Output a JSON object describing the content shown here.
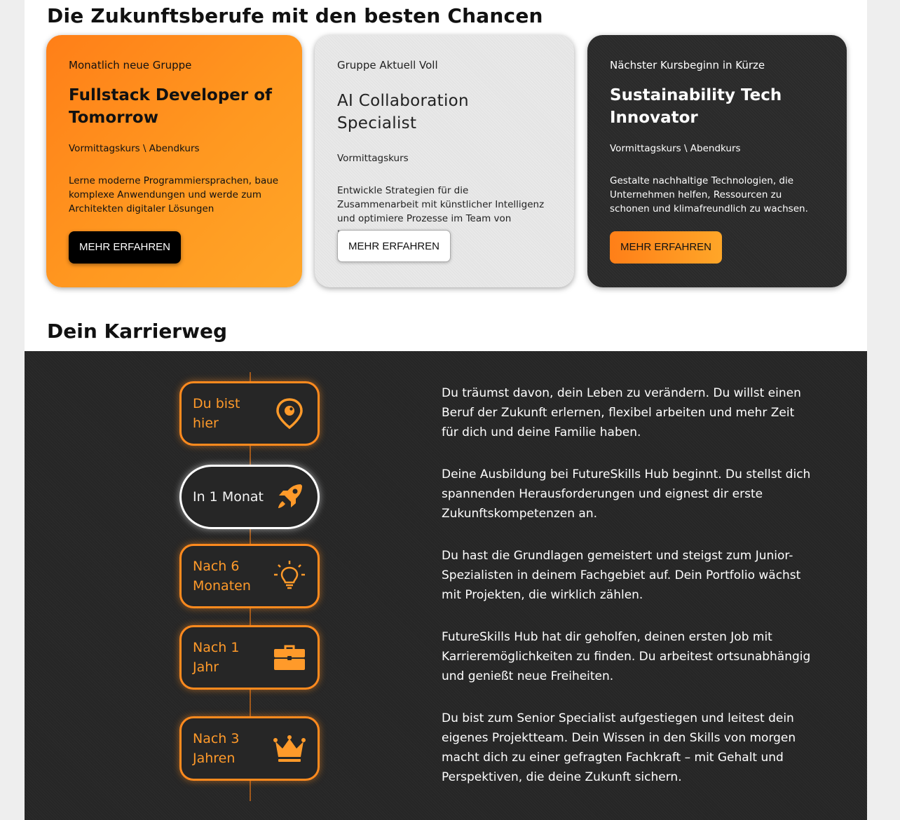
{
  "section_courses": {
    "heading": "Die Zukunftsberufe mit den besten Chancen",
    "cards": [
      {
        "status": "Monatlich neue Gruppe",
        "title": "Fullstack Developer of Tomorrow",
        "schedule": "Vormittagskurs \\ Abendkurs",
        "description": "Lerne moderne Programmiersprachen, baue komplexe Anwendungen und werde zum Architekten digitaler Lösungen",
        "button": "MEHR ERFAHREN"
      },
      {
        "status": "Gruppe Aktuell Voll",
        "title": "AI Collaboration Specialist",
        "schedule": "Vormittagskurs",
        "description": "Entwickle Strategien für die Zusammenarbeit mit künstlicher Intelligenz und optimiere Prozesse im Team von morgen.",
        "button": "MEHR ERFAHREN"
      },
      {
        "status": "Nächster Kursbeginn in Kürze",
        "title": "Sustainability Tech Innovator",
        "schedule": "Vormittagskurs \\ Abendkurs",
        "description": "Gestalte nachhaltige Technologien, die Unternehmen helfen, Ressourcen zu schonen und klimafreundlich zu wachsen.",
        "button": "MEHR ERFAHREN"
      }
    ]
  },
  "section_career": {
    "heading": "Dein Karrierweg",
    "steps": [
      {
        "label": "Du bist hier",
        "icon": "location-pin-icon",
        "text": "Du träumst davon, dein Leben zu verändern. Du willst einen Beruf der Zukunft erlernen, flexibel arbeiten und mehr Zeit für dich und deine Familie haben."
      },
      {
        "label": "In 1 Monat",
        "icon": "rocket-icon",
        "text": "Deine Ausbildung bei FutureSkills Hub beginnt. Du stellst dich spannenden Herausforderungen und eignest dir erste Zukunftskompetenzen an."
      },
      {
        "label": "Nach 6 Monaten",
        "icon": "lightbulb-icon",
        "text": "Du hast die Grundlagen gemeistert und steigst zum Junior-Spezialisten in deinem Fachgebiet auf. Dein Portfolio wächst mit Projekten, die wirklich zählen."
      },
      {
        "label": "Nach 1 Jahr",
        "icon": "briefcase-icon",
        "text": "FutureSkills Hub hat dir geholfen, deinen ersten Job mit Karrieremöglichkeiten zu finden. Du arbeitest ortsunabhängig und genießt neue Freiheiten."
      },
      {
        "label": "Nach 3 Jahren",
        "icon": "crown-icon",
        "text": "Du bist zum Senior Specialist aufgestiegen und leitest dein eigenes Projektteam. Dein Wissen in den Skills von morgen macht dich zu einer gefragten Fachkraft – mit Gehalt und Perspektiven, die deine Zukunft sichern."
      }
    ]
  },
  "colors": {
    "accent": "#ff8a1e",
    "dark_bg": "#262626",
    "light_card": "#e4e4e4"
  }
}
